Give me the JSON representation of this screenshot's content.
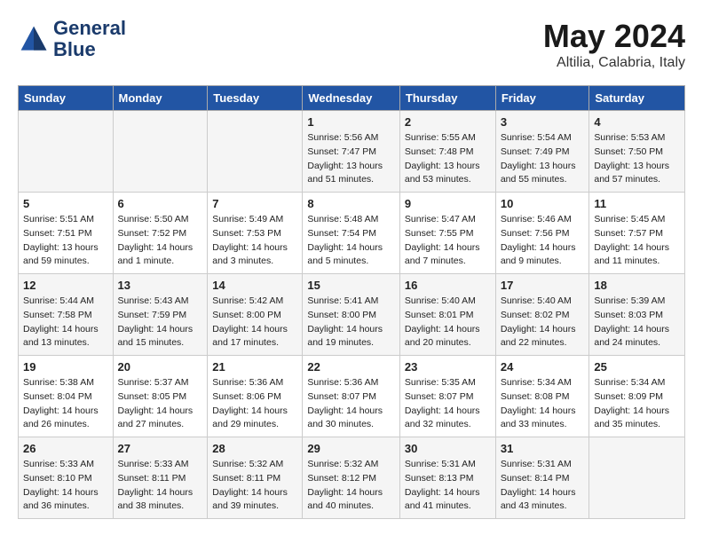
{
  "header": {
    "logo_line1": "General",
    "logo_line2": "Blue",
    "month": "May 2024",
    "location": "Altilia, Calabria, Italy"
  },
  "weekdays": [
    "Sunday",
    "Monday",
    "Tuesday",
    "Wednesday",
    "Thursday",
    "Friday",
    "Saturday"
  ],
  "weeks": [
    [
      {
        "day": "",
        "info": ""
      },
      {
        "day": "",
        "info": ""
      },
      {
        "day": "",
        "info": ""
      },
      {
        "day": "1",
        "info": "Sunrise: 5:56 AM\nSunset: 7:47 PM\nDaylight: 13 hours\nand 51 minutes."
      },
      {
        "day": "2",
        "info": "Sunrise: 5:55 AM\nSunset: 7:48 PM\nDaylight: 13 hours\nand 53 minutes."
      },
      {
        "day": "3",
        "info": "Sunrise: 5:54 AM\nSunset: 7:49 PM\nDaylight: 13 hours\nand 55 minutes."
      },
      {
        "day": "4",
        "info": "Sunrise: 5:53 AM\nSunset: 7:50 PM\nDaylight: 13 hours\nand 57 minutes."
      }
    ],
    [
      {
        "day": "5",
        "info": "Sunrise: 5:51 AM\nSunset: 7:51 PM\nDaylight: 13 hours\nand 59 minutes."
      },
      {
        "day": "6",
        "info": "Sunrise: 5:50 AM\nSunset: 7:52 PM\nDaylight: 14 hours\nand 1 minute."
      },
      {
        "day": "7",
        "info": "Sunrise: 5:49 AM\nSunset: 7:53 PM\nDaylight: 14 hours\nand 3 minutes."
      },
      {
        "day": "8",
        "info": "Sunrise: 5:48 AM\nSunset: 7:54 PM\nDaylight: 14 hours\nand 5 minutes."
      },
      {
        "day": "9",
        "info": "Sunrise: 5:47 AM\nSunset: 7:55 PM\nDaylight: 14 hours\nand 7 minutes."
      },
      {
        "day": "10",
        "info": "Sunrise: 5:46 AM\nSunset: 7:56 PM\nDaylight: 14 hours\nand 9 minutes."
      },
      {
        "day": "11",
        "info": "Sunrise: 5:45 AM\nSunset: 7:57 PM\nDaylight: 14 hours\nand 11 minutes."
      }
    ],
    [
      {
        "day": "12",
        "info": "Sunrise: 5:44 AM\nSunset: 7:58 PM\nDaylight: 14 hours\nand 13 minutes."
      },
      {
        "day": "13",
        "info": "Sunrise: 5:43 AM\nSunset: 7:59 PM\nDaylight: 14 hours\nand 15 minutes."
      },
      {
        "day": "14",
        "info": "Sunrise: 5:42 AM\nSunset: 8:00 PM\nDaylight: 14 hours\nand 17 minutes."
      },
      {
        "day": "15",
        "info": "Sunrise: 5:41 AM\nSunset: 8:00 PM\nDaylight: 14 hours\nand 19 minutes."
      },
      {
        "day": "16",
        "info": "Sunrise: 5:40 AM\nSunset: 8:01 PM\nDaylight: 14 hours\nand 20 minutes."
      },
      {
        "day": "17",
        "info": "Sunrise: 5:40 AM\nSunset: 8:02 PM\nDaylight: 14 hours\nand 22 minutes."
      },
      {
        "day": "18",
        "info": "Sunrise: 5:39 AM\nSunset: 8:03 PM\nDaylight: 14 hours\nand 24 minutes."
      }
    ],
    [
      {
        "day": "19",
        "info": "Sunrise: 5:38 AM\nSunset: 8:04 PM\nDaylight: 14 hours\nand 26 minutes."
      },
      {
        "day": "20",
        "info": "Sunrise: 5:37 AM\nSunset: 8:05 PM\nDaylight: 14 hours\nand 27 minutes."
      },
      {
        "day": "21",
        "info": "Sunrise: 5:36 AM\nSunset: 8:06 PM\nDaylight: 14 hours\nand 29 minutes."
      },
      {
        "day": "22",
        "info": "Sunrise: 5:36 AM\nSunset: 8:07 PM\nDaylight: 14 hours\nand 30 minutes."
      },
      {
        "day": "23",
        "info": "Sunrise: 5:35 AM\nSunset: 8:07 PM\nDaylight: 14 hours\nand 32 minutes."
      },
      {
        "day": "24",
        "info": "Sunrise: 5:34 AM\nSunset: 8:08 PM\nDaylight: 14 hours\nand 33 minutes."
      },
      {
        "day": "25",
        "info": "Sunrise: 5:34 AM\nSunset: 8:09 PM\nDaylight: 14 hours\nand 35 minutes."
      }
    ],
    [
      {
        "day": "26",
        "info": "Sunrise: 5:33 AM\nSunset: 8:10 PM\nDaylight: 14 hours\nand 36 minutes."
      },
      {
        "day": "27",
        "info": "Sunrise: 5:33 AM\nSunset: 8:11 PM\nDaylight: 14 hours\nand 38 minutes."
      },
      {
        "day": "28",
        "info": "Sunrise: 5:32 AM\nSunset: 8:11 PM\nDaylight: 14 hours\nand 39 minutes."
      },
      {
        "day": "29",
        "info": "Sunrise: 5:32 AM\nSunset: 8:12 PM\nDaylight: 14 hours\nand 40 minutes."
      },
      {
        "day": "30",
        "info": "Sunrise: 5:31 AM\nSunset: 8:13 PM\nDaylight: 14 hours\nand 41 minutes."
      },
      {
        "day": "31",
        "info": "Sunrise: 5:31 AM\nSunset: 8:14 PM\nDaylight: 14 hours\nand 43 minutes."
      },
      {
        "day": "",
        "info": ""
      }
    ]
  ]
}
